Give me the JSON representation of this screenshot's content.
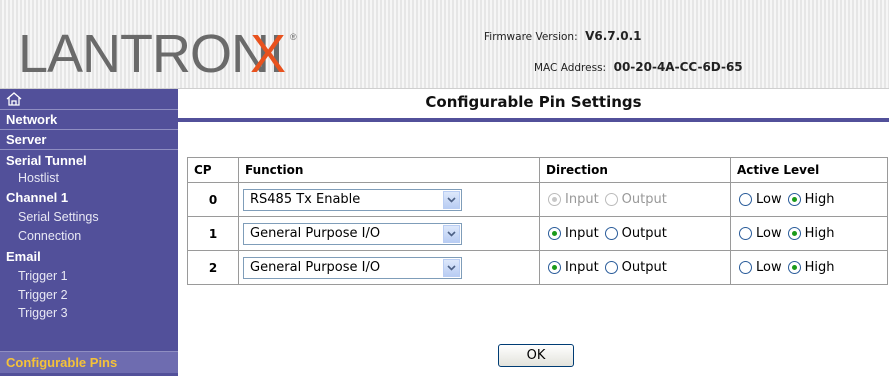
{
  "header": {
    "logo_text": "LANTRONIX",
    "firmware_label": "Firmware Version:",
    "firmware_value": "V6.7.0.1",
    "mac_label": "MAC Address:",
    "mac_value": "00-20-4A-CC-6D-65"
  },
  "sidebar": {
    "items": [
      {
        "label": "Network"
      },
      {
        "label": "Server"
      },
      {
        "label": "Serial Tunnel"
      },
      {
        "label": "Hostlist"
      },
      {
        "label": "Channel 1"
      },
      {
        "label": "Serial Settings"
      },
      {
        "label": "Connection"
      },
      {
        "label": "Email"
      },
      {
        "label": "Trigger 1"
      },
      {
        "label": "Trigger 2"
      },
      {
        "label": "Trigger 3"
      },
      {
        "label": "Configurable Pins"
      }
    ],
    "active_color": "#f5c238",
    "bg_color": "#52509a"
  },
  "page": {
    "title": "Configurable Pin Settings"
  },
  "table": {
    "headers": [
      "CP",
      "Function",
      "Direction",
      "Active Level"
    ],
    "rows": [
      {
        "cp": "0",
        "function": "RS485 Tx Enable",
        "direction_disabled": true,
        "direction": "Input",
        "level": "High"
      },
      {
        "cp": "1",
        "function": "General Purpose I/O",
        "direction_disabled": false,
        "direction": "Input",
        "level": "High"
      },
      {
        "cp": "2",
        "function": "General Purpose I/O",
        "direction_disabled": false,
        "direction": "Input",
        "level": "High"
      }
    ],
    "options": {
      "input": "Input",
      "output": "Output",
      "low": "Low",
      "high": "High"
    }
  },
  "ok_label": "OK"
}
